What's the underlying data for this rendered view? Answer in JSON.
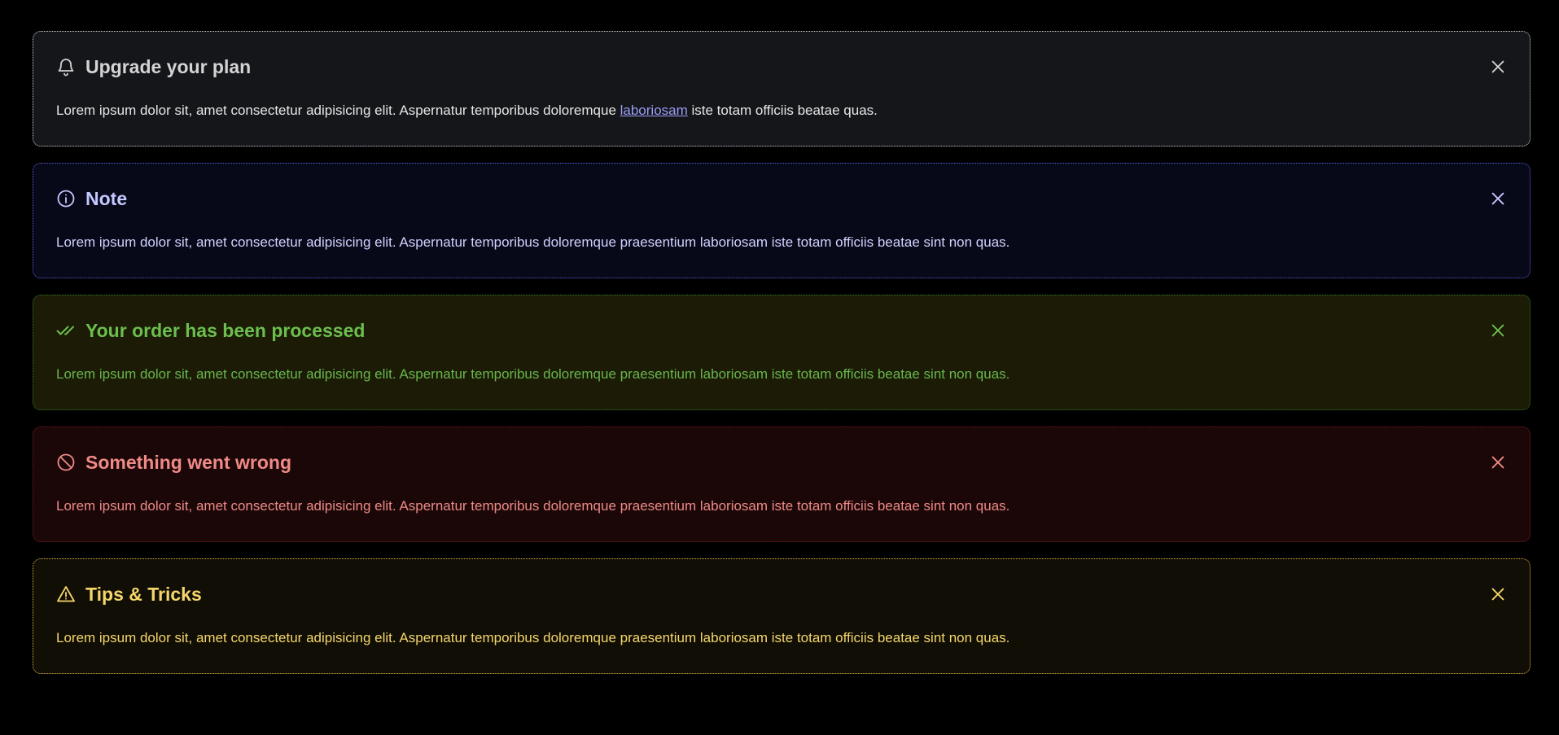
{
  "alerts": [
    {
      "variant": "neutral",
      "icon": "bell-icon",
      "title": "Upgrade your plan",
      "body_before": "Lorem ipsum dolor sit, amet consectetur adipisicing elit. Aspernatur temporibus doloremque ",
      "body_link": "laboriosam",
      "body_after": " iste totam officiis beatae quas.",
      "color": "#d4d4d4"
    },
    {
      "variant": "info",
      "icon": "info-circle-icon",
      "title": "Note",
      "body": "Lorem ipsum dolor sit, amet consectetur adipisicing elit. Aspernatur temporibus doloremque praesentium laboriosam iste totam officiis beatae sint non quas.",
      "color": "#c5c8ff"
    },
    {
      "variant": "success",
      "icon": "double-check-icon",
      "title": "Your order has been processed",
      "body": "Lorem ipsum dolor sit, amet consectetur adipisicing elit. Aspernatur temporibus doloremque praesentium laboriosam iste totam officiis beatae sint non quas.",
      "color": "#6cbf4e"
    },
    {
      "variant": "error",
      "icon": "ban-icon",
      "title": "Something went wrong",
      "body": "Lorem ipsum dolor sit, amet consectetur adipisicing elit. Aspernatur temporibus doloremque praesentium laboriosam iste totam officiis beatae sint non quas.",
      "color": "#ef8a86"
    },
    {
      "variant": "warning",
      "icon": "warning-triangle-icon",
      "title": "Tips & Tricks",
      "body": "Lorem ipsum dolor sit, amet consectetur adipisicing elit. Aspernatur temporibus doloremque praesentium laboriosam iste totam officiis beatae sint non quas.",
      "color": "#f5d66a"
    }
  ]
}
